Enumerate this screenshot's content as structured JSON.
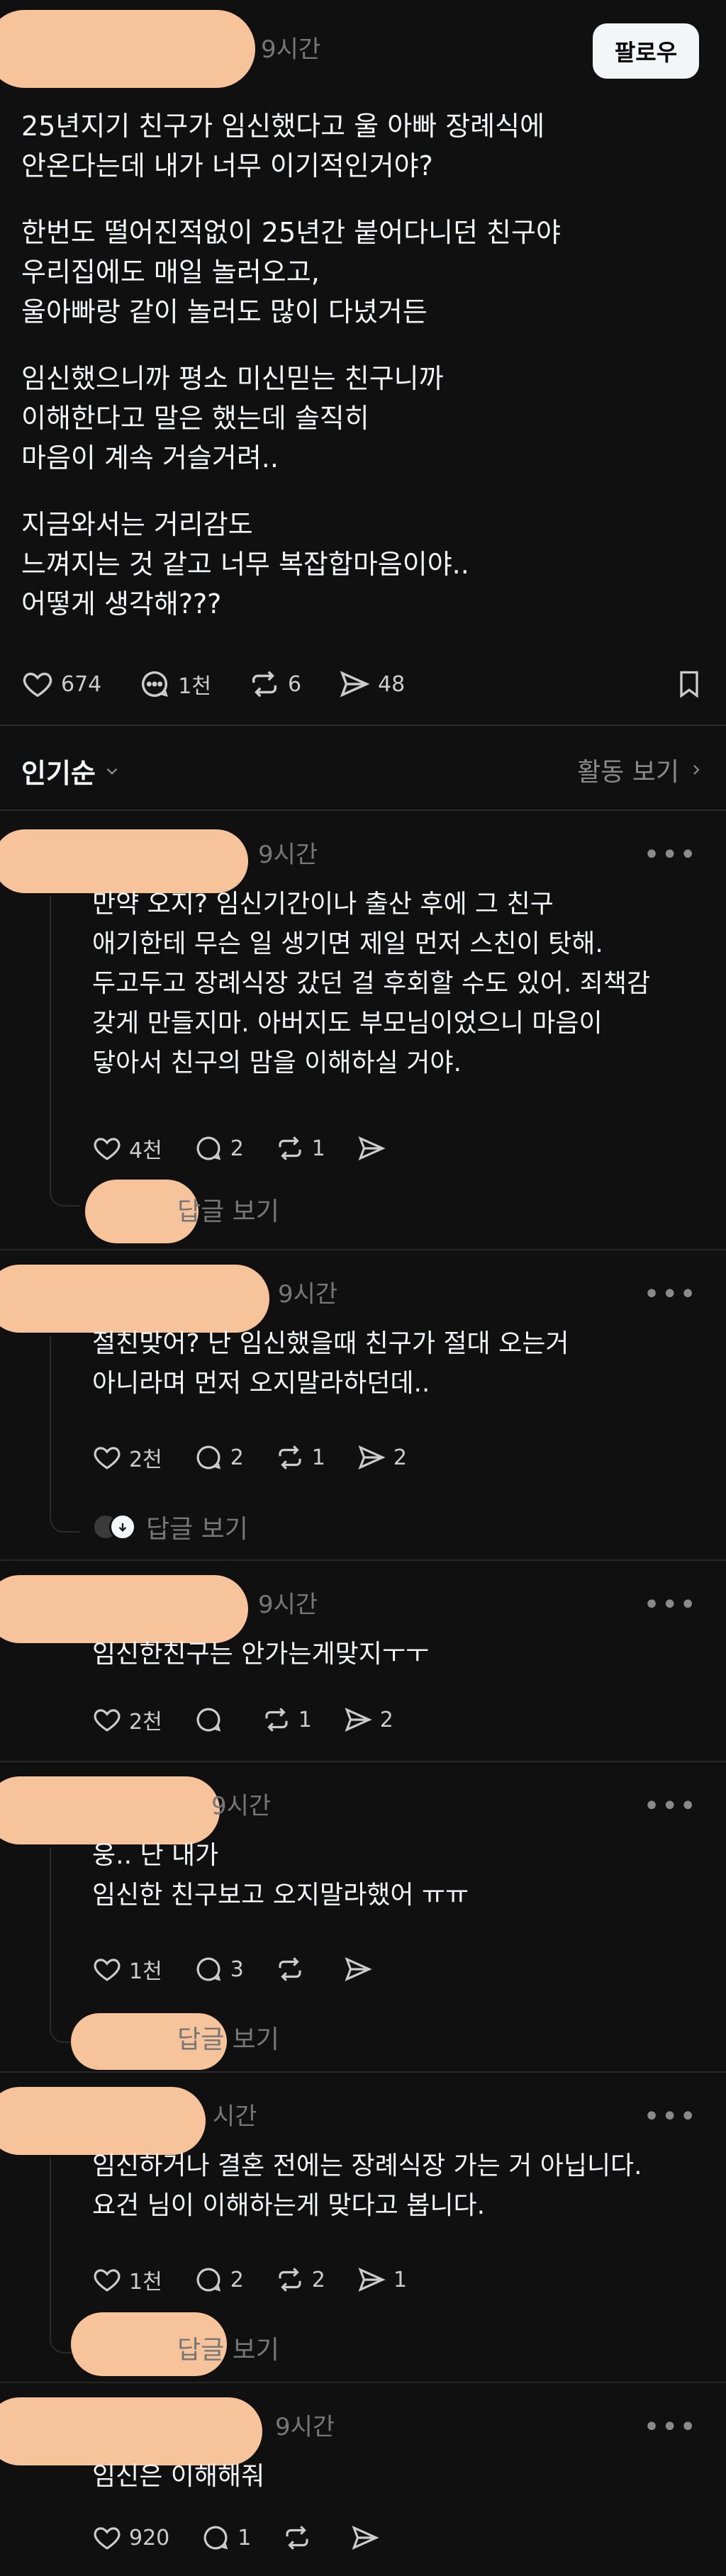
{
  "post": {
    "time": "9시간",
    "follow_label": "팔로우",
    "paragraphs": [
      [
        "25년지기 친구가 임신했다고 울 아빠 장례식에",
        "안온다는데 내가 너무 이기적인거야?"
      ],
      [
        "한번도 떨어진적없이 25년간 붙어다니던 친구야",
        "우리집에도 매일 놀러오고,",
        "울아빠랑 같이 놀러도 많이 다녔거든"
      ],
      [
        "임신했으니까 평소 미신믿는 친구니까",
        "이해한다고 말은 했는데 솔직히",
        "마음이 계속 거슬거려.."
      ],
      [
        "지금와서는 거리감도",
        "느껴지는 것 같고 너무 복잡합마음이야..",
        "어떻게 생각해???"
      ]
    ],
    "likes": "674",
    "comments": "1천",
    "reposts": "6",
    "shares": "48"
  },
  "sort": {
    "label": "인기순",
    "activity_label": "활동 보기"
  },
  "comments": [
    {
      "time": "9시간",
      "lines": [
        "만약 오지? 임신기간이나 출산 후에 그 친구",
        "애기한테 무슨 일  생기면 제일 먼저 스친이 탓해.",
        "두고두고 장례식장 갔던 걸 후회할 수도 있어. 죄책감",
        "갖게 만들지마. 아버지도 부모님이었으니 마음이",
        "닿아서 친구의 맘을 이해하실 거야."
      ],
      "likes": "4천",
      "replies": "2",
      "reposts": "1",
      "shares": "",
      "replies_label": "답글 보기"
    },
    {
      "time": "9시간",
      "lines": [
        "절친맞어? 난 임신했을때 친구가 절대 오는거",
        "아니라며 먼저 오지말라하던데.."
      ],
      "likes": "2천",
      "replies": "2",
      "reposts": "1",
      "shares": "2",
      "replies_label": "답글 보기"
    },
    {
      "time": "9시간",
      "lines": [
        "임신한친구는 안가는게맞지ㅜㅜ"
      ],
      "likes": "2천",
      "replies": "",
      "reposts": "1",
      "shares": "2",
      "replies_label": ""
    },
    {
      "time": "9시간",
      "lines": [
        "웅.. 난 내가",
        "임신한 친구보고 오지말라했어 ㅠㅠ"
      ],
      "likes": "1천",
      "replies": "3",
      "reposts": "",
      "shares": "",
      "replies_label": "답글 보기"
    },
    {
      "time": "시간",
      "lines": [
        "임신하거나 결혼 전에는 장례식장 가는 거 아닙니다.",
        "요건 님이 이해하는게 맞다고 봅니다."
      ],
      "likes": "1천",
      "replies": "2",
      "reposts": "2",
      "shares": "1",
      "replies_label": "답글 보기"
    },
    {
      "time": "9시간",
      "lines": [
        "임신은 이해해줘"
      ],
      "likes": "920",
      "replies": "1",
      "reposts": "",
      "shares": "",
      "replies_label": ""
    }
  ],
  "colors": {
    "background": "#101010",
    "text": "#f3f5f7",
    "muted": "#777777",
    "redaction": "#f6c39b"
  }
}
